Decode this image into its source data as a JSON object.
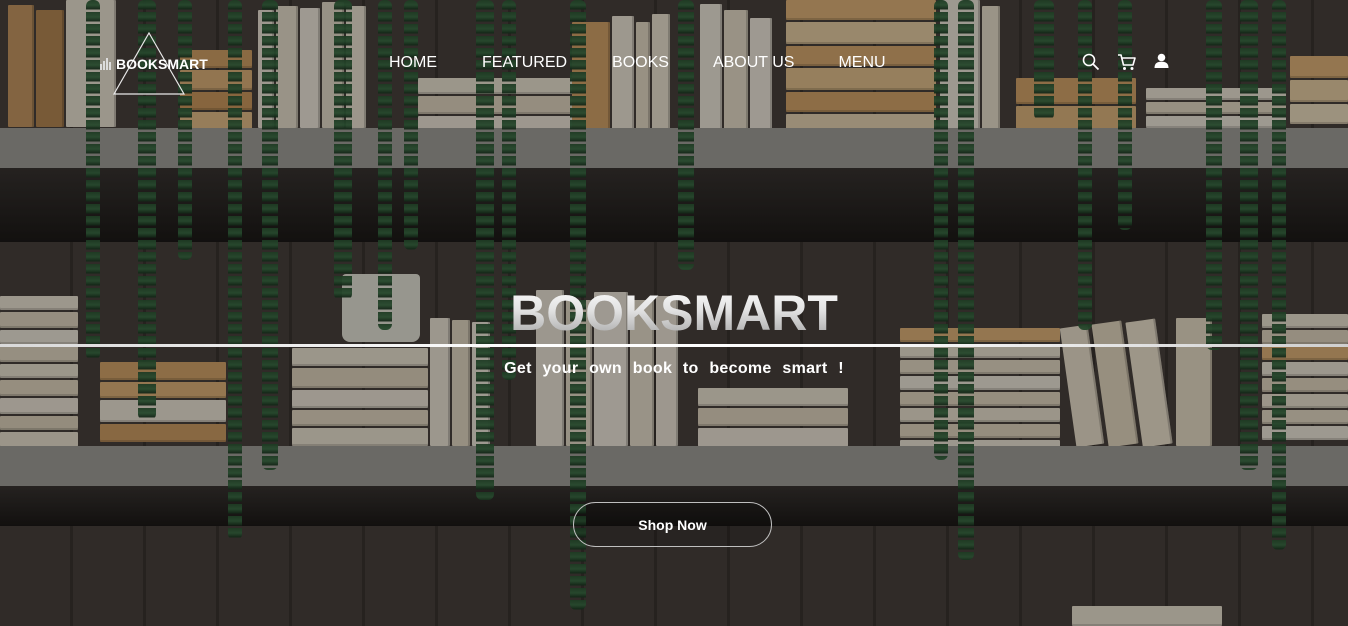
{
  "brand": {
    "name": "BOOKSMART"
  },
  "nav": {
    "items": [
      {
        "label": "HOME"
      },
      {
        "label": "FEATURED"
      },
      {
        "label": "BOOKS"
      },
      {
        "label": "ABOUT US"
      },
      {
        "label": "MENU"
      }
    ]
  },
  "header_icons": [
    "search-icon",
    "cart-icon",
    "user-icon"
  ],
  "hero": {
    "title": "BOOKSMART",
    "subtitle": "Get your own book to become smart !",
    "button_label": "Shop Now"
  },
  "colors": {
    "text": "#ffffff",
    "shelf": "#a4a29c",
    "vine": "#2f5a36",
    "book": "#e8dcc8"
  }
}
